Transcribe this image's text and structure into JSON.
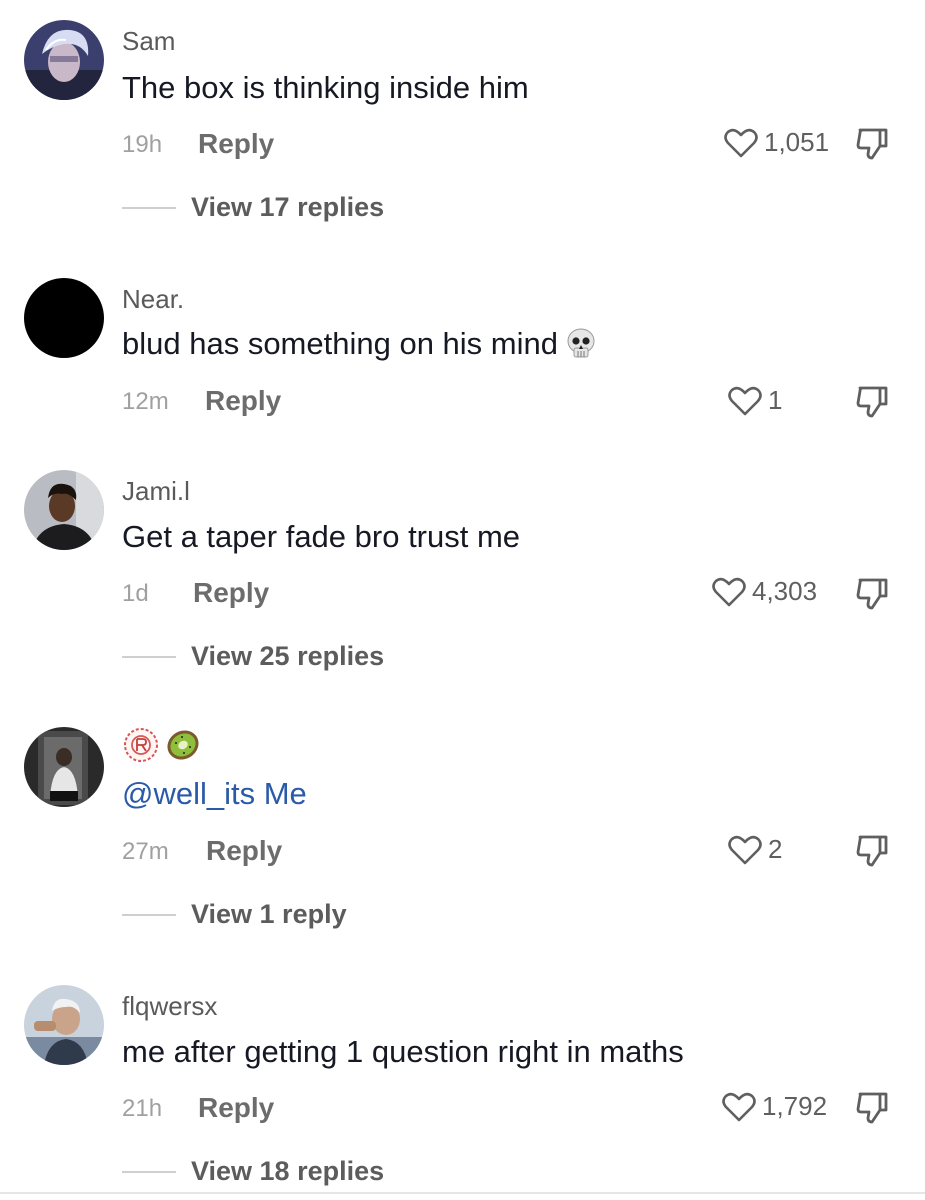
{
  "comments": [
    {
      "username": "Sam",
      "text": "The box is thinking inside him",
      "time": "19h",
      "reply_label": "Reply",
      "likes": "1,051",
      "view_replies": "View 17 replies"
    },
    {
      "username": "Near.",
      "text": "blud has something on his mind",
      "text_emoji": "skull-emoji",
      "time": "12m",
      "reply_label": "Reply",
      "likes": "1"
    },
    {
      "username": "Jami.l",
      "text": "Get a taper fade bro trust me",
      "time": "1d",
      "reply_label": "Reply",
      "likes": "4,303",
      "view_replies": "View 25 replies"
    },
    {
      "username_emojis": [
        "red-emblem-emoji",
        "kiwi-emoji"
      ],
      "text": "@well_its Me",
      "time": "27m",
      "reply_label": "Reply",
      "likes": "2",
      "view_replies": "View 1 reply"
    },
    {
      "username": "flqwersx",
      "text": "me after getting 1 question right in maths",
      "time": "21h",
      "reply_label": "Reply",
      "likes": "1,792",
      "view_replies": "View 18 replies"
    }
  ],
  "icons": {
    "like": "heart-outline-icon",
    "dislike": "thumbs-down-icon"
  },
  "colors": {
    "mention": "#2b5aa8",
    "username": "#5a5a5a",
    "meta": "#a0a0a0"
  }
}
